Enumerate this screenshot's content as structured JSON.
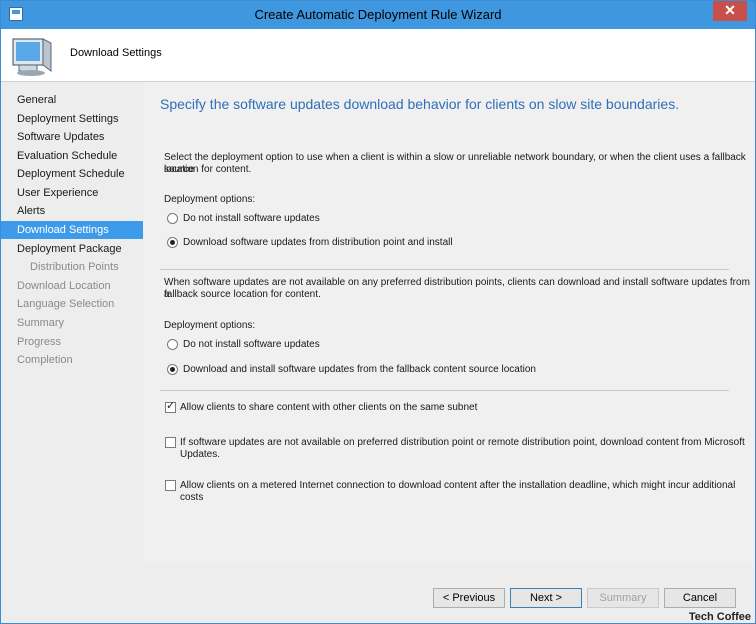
{
  "window": {
    "title": "Create Automatic Deployment Rule Wizard",
    "close_glyph": "✕"
  },
  "header": {
    "page_title": "Download Settings",
    "icon": "computer-icon"
  },
  "sidebar": {
    "items": [
      {
        "label": "General",
        "state": "normal"
      },
      {
        "label": "Deployment Settings",
        "state": "normal"
      },
      {
        "label": "Software Updates",
        "state": "normal"
      },
      {
        "label": "Evaluation Schedule",
        "state": "normal"
      },
      {
        "label": "Deployment Schedule",
        "state": "normal"
      },
      {
        "label": "User Experience",
        "state": "normal"
      },
      {
        "label": "Alerts",
        "state": "normal"
      },
      {
        "label": "Download Settings",
        "state": "active"
      },
      {
        "label": "Deployment Package",
        "state": "normal"
      },
      {
        "label": "Distribution Points",
        "state": "sub"
      },
      {
        "label": "Download Location",
        "state": "disabled"
      },
      {
        "label": "Language Selection",
        "state": "disabled"
      },
      {
        "label": "Summary",
        "state": "disabled"
      },
      {
        "label": "Progress",
        "state": "disabled"
      },
      {
        "label": "Completion",
        "state": "disabled"
      }
    ]
  },
  "main": {
    "heading": "Specify the software updates download behavior for clients on slow site boundaries.",
    "section1": {
      "description_line1": "Select the deployment option to use when a client is within a slow or unreliable network boundary, or when the client uses a fallback source",
      "description_line2": "location for content.",
      "options_label": "Deployment options:",
      "option_no_install": "Do not install software updates",
      "option_download": "Download software updates from distribution point and install"
    },
    "section2": {
      "description_line1": "When software updates are not available on any preferred distribution points, clients can download and install software updates from a",
      "description_line2": "fallback source location for content.",
      "options_label": "Deployment options:",
      "option_no_install": "Do not install software updates",
      "option_download": "Download and install software updates from the fallback content source location"
    },
    "checkboxes": {
      "share_content": "Allow clients to share content with other clients on the same subnet",
      "microsoft_updates": "If software updates are not available on preferred distribution point or remote distribution point, download content from Microsoft Updates.",
      "metered": "Allow clients on a metered Internet connection to download content after the installation deadline, which might incur additional costs"
    }
  },
  "footer": {
    "previous": "< Previous",
    "next": "Next >",
    "summary": "Summary",
    "cancel": "Cancel"
  },
  "watermark": "Tech Coffee"
}
